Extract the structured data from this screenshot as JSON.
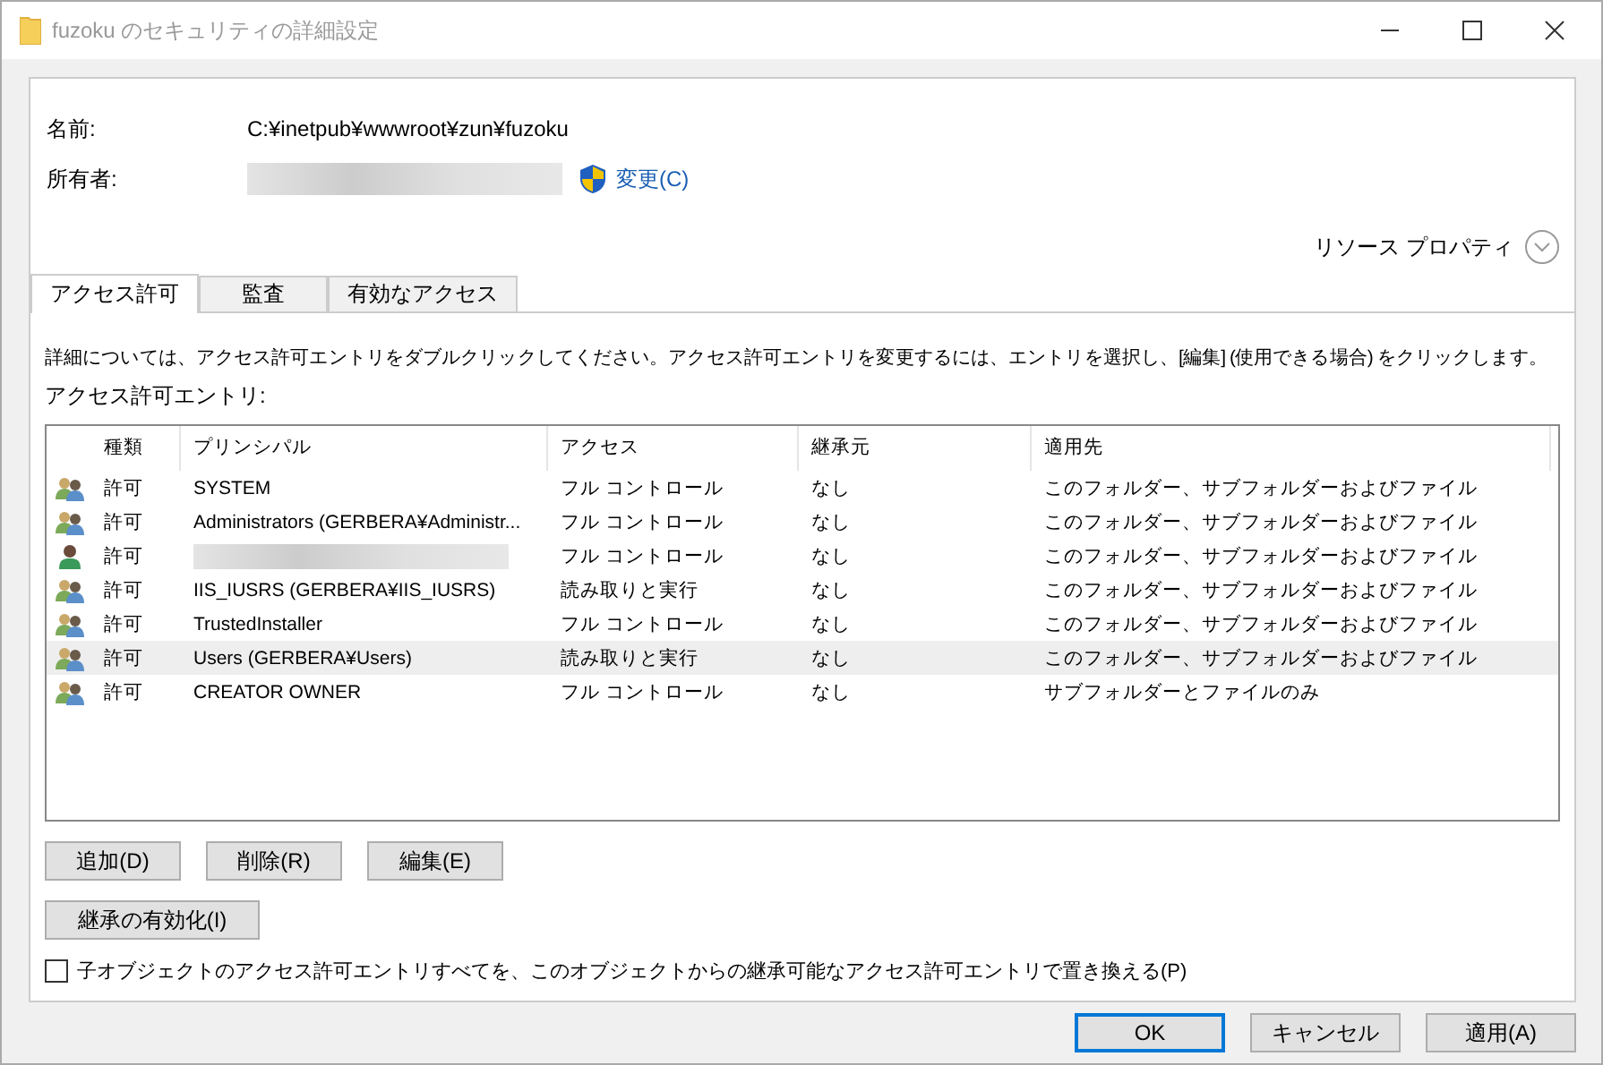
{
  "window": {
    "title": "fuzoku のセキュリティの詳細設定"
  },
  "name_label": "名前:",
  "name_value": "C:¥inetpub¥wwwroot¥zun¥fuzoku",
  "owner_label": "所有者:",
  "owner_redacted": true,
  "change_link": "変更(C)",
  "resource_properties": "リソース プロパティ",
  "tabs": [
    {
      "label": "アクセス許可",
      "selected": true
    },
    {
      "label": "監査",
      "selected": false
    },
    {
      "label": "有効なアクセス",
      "selected": false
    }
  ],
  "instructions": "詳細については、アクセス許可エントリをダブルクリックしてください。アクセス許可エントリを変更するには、エントリを選択し、[編集] (使用できる場合) をクリックします。",
  "entries_label": "アクセス許可エントリ:",
  "table": {
    "columns": [
      "種類",
      "プリンシパル",
      "アクセス",
      "継承元",
      "適用先"
    ],
    "rows": [
      {
        "kind": "group",
        "type": "許可",
        "principal": "SYSTEM",
        "principal_redacted": false,
        "access": "フル コントロール",
        "inherited_from": "なし",
        "applies_to": "このフォルダー、サブフォルダーおよびファイル",
        "selected": false
      },
      {
        "kind": "group",
        "type": "許可",
        "principal": "Administrators (GERBERA¥Administr...",
        "principal_redacted": false,
        "access": "フル コントロール",
        "inherited_from": "なし",
        "applies_to": "このフォルダー、サブフォルダーおよびファイル",
        "selected": false
      },
      {
        "kind": "user",
        "type": "許可",
        "principal_redacted": true,
        "access": "フル コントロール",
        "inherited_from": "なし",
        "applies_to": "このフォルダー、サブフォルダーおよびファイル",
        "selected": false
      },
      {
        "kind": "group",
        "type": "許可",
        "principal": "IIS_IUSRS (GERBERA¥IIS_IUSRS)",
        "principal_redacted": false,
        "access": "読み取りと実行",
        "inherited_from": "なし",
        "applies_to": "このフォルダー、サブフォルダーおよびファイル",
        "selected": false
      },
      {
        "kind": "group",
        "type": "許可",
        "principal": "TrustedInstaller",
        "principal_redacted": false,
        "access": "フル コントロール",
        "inherited_from": "なし",
        "applies_to": "このフォルダー、サブフォルダーおよびファイル",
        "selected": false
      },
      {
        "kind": "group",
        "type": "許可",
        "principal": "Users (GERBERA¥Users)",
        "principal_redacted": false,
        "access": "読み取りと実行",
        "inherited_from": "なし",
        "applies_to": "このフォルダー、サブフォルダーおよびファイル",
        "selected": true
      },
      {
        "kind": "group",
        "type": "許可",
        "principal": "CREATOR OWNER",
        "principal_redacted": false,
        "access": "フル コントロール",
        "inherited_from": "なし",
        "applies_to": "サブフォルダーとファイルのみ",
        "selected": false
      }
    ]
  },
  "entry_buttons": [
    "追加(D)",
    "削除(R)",
    "編集(E)"
  ],
  "inheritance_button": "継承の有効化(I)",
  "replace_checkbox": {
    "label": "子オブジェクトのアクセス許可エントリすべてを、このオブジェクトからの継承可能なアクセス許可エントリで置き換える(P)",
    "checked": false
  },
  "dialog_buttons": [
    {
      "label": "OK",
      "default": true
    },
    {
      "label": "キャンセル",
      "default": false
    },
    {
      "label": "適用(A)",
      "default": false
    }
  ]
}
